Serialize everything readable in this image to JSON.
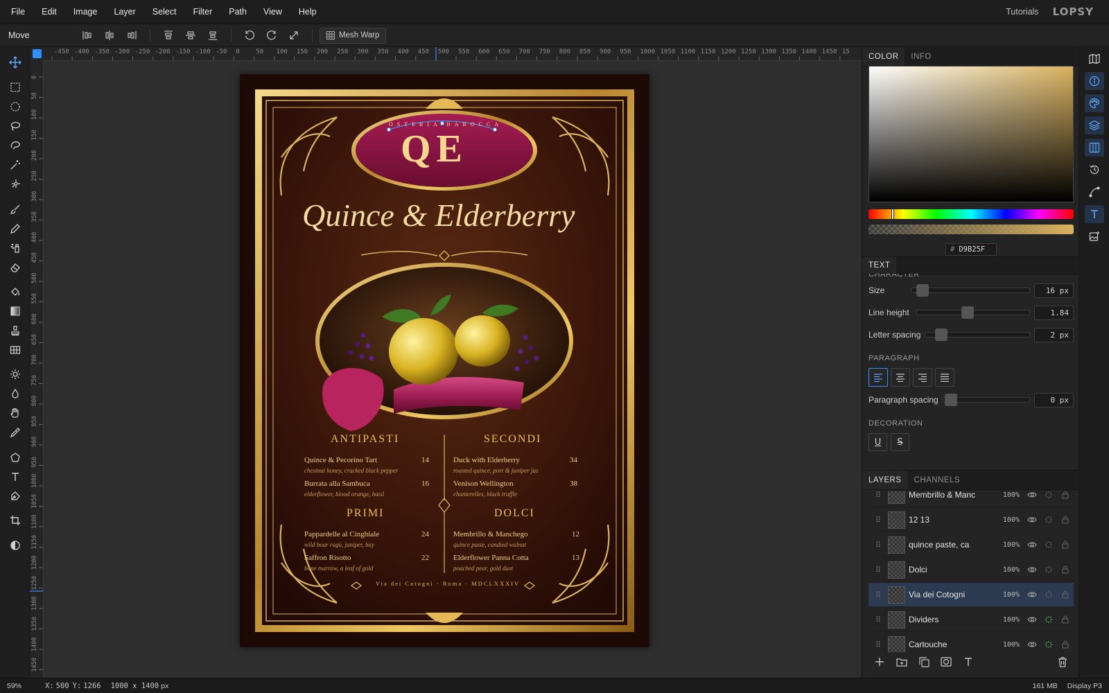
{
  "menubar": {
    "items": [
      "File",
      "Edit",
      "Image",
      "Layer",
      "Select",
      "Filter",
      "Path",
      "View",
      "Help"
    ],
    "tutorials": "Tutorials",
    "logo": "LOPSY"
  },
  "options_bar": {
    "tool_name": "Move",
    "mesh_warp_label": "Mesh Warp"
  },
  "ruler": {
    "top_labels": [
      "-450",
      "-400",
      "-350",
      "-300",
      "-250",
      "-200",
      "-150",
      "-100",
      "-50",
      "0",
      "50",
      "100",
      "150",
      "200",
      "250",
      "300",
      "350",
      "400",
      "450",
      "500",
      "550",
      "600",
      "650",
      "700",
      "750",
      "800",
      "850",
      "900",
      "950",
      "1000",
      "1050",
      "1100",
      "1150",
      "1200",
      "1250",
      "1300",
      "1350",
      "1400",
      "1450",
      "15"
    ],
    "left_labels": [
      "0",
      "50",
      "100",
      "150",
      "200",
      "250",
      "300",
      "350",
      "400",
      "450",
      "500",
      "550",
      "600",
      "650",
      "700",
      "750",
      "800",
      "850",
      "900",
      "950",
      "1000",
      "1050",
      "1100",
      "1150",
      "1200",
      "1250",
      "1300",
      "1350",
      "1400",
      "1450"
    ]
  },
  "document": {
    "arch_text": "OSTERIA BAROCCA",
    "monogram": "QE",
    "title": "Quince & Elderberry",
    "sections": {
      "antipasti": {
        "heading": "ANTIPASTI",
        "items": [
          {
            "name": "Quince & Pecorino Tart",
            "price": "14",
            "desc": "chestnut honey, cracked black pepper"
          },
          {
            "name": "Burrata alla Sambuca",
            "price": "16",
            "desc": "elderflower, blood orange, basil"
          }
        ]
      },
      "secondi": {
        "heading": "SECONDI",
        "items": [
          {
            "name": "Duck with Elderberry",
            "price": "34",
            "desc": "roasted quince, port & juniper jus"
          },
          {
            "name": "Venison Wellington",
            "price": "38",
            "desc": "chanterelles, black truffle"
          }
        ]
      },
      "primi": {
        "heading": "PRIMI",
        "items": [
          {
            "name": "Pappardelle al Cinghiale",
            "price": "24",
            "desc": "wild boar ragù, juniper, bay"
          },
          {
            "name": "Saffron Risotto",
            "price": "22",
            "desc": "bone marrow, a leaf of gold"
          }
        ]
      },
      "dolci": {
        "heading": "DOLCI",
        "items": [
          {
            "name": "Membrillo & Manchego",
            "price": "12",
            "desc": "quince paste, candied walnut"
          },
          {
            "name": "Elderflower Panna Cotta",
            "price": "13",
            "desc": "poached pear, gold dust"
          }
        ]
      }
    },
    "footer": "Via dei Cotogni · Roma · MDCLXXXIV"
  },
  "color_panel": {
    "tabs": [
      "COLOR",
      "INFO"
    ],
    "hex_prefix": "#",
    "hex": "D9B25F",
    "hue_position": 0.11
  },
  "text_panel": {
    "title": "TEXT",
    "character_header": "CHARACTER",
    "size_label": "Size",
    "size_value": "16 px",
    "line_height_label": "Line height",
    "line_height_value": "1.84",
    "letter_spacing_label": "Letter spacing",
    "letter_spacing_value": "2 px",
    "paragraph_header": "PARAGRAPH",
    "paragraph_spacing_label": "Paragraph spacing",
    "paragraph_spacing_value": "0 px",
    "decoration_header": "DECORATION",
    "underline_label": "U",
    "strike_label": "S"
  },
  "layers_panel": {
    "tabs": [
      "LAYERS",
      "CHANNELS"
    ],
    "layers": [
      {
        "name": "Membrillo & Manc",
        "opacity": "100%"
      },
      {
        "name": "12 13",
        "opacity": "100%"
      },
      {
        "name": "quince paste, ca",
        "opacity": "100%"
      },
      {
        "name": "Dolci",
        "opacity": "100%"
      },
      {
        "name": "Via dei Cotogni",
        "opacity": "100%"
      },
      {
        "name": "Dividers",
        "opacity": "100%"
      },
      {
        "name": "Cartouche",
        "opacity": "100%"
      }
    ],
    "selected_layer": "Via dei Cotogni"
  },
  "statusbar": {
    "zoom": "59%",
    "x_label": "X:",
    "x_value": "500",
    "y_label": "Y:",
    "y_value": "1266",
    "canvas_size": "1000 x 1400",
    "canvas_unit": "px",
    "memory": "161 MB",
    "color_profile": "Display P3"
  },
  "colors": {
    "accent": "#2f8fff",
    "gold": "#d9b25f",
    "menu_background": "#2a0e08",
    "cartouche": "#8c1440"
  }
}
